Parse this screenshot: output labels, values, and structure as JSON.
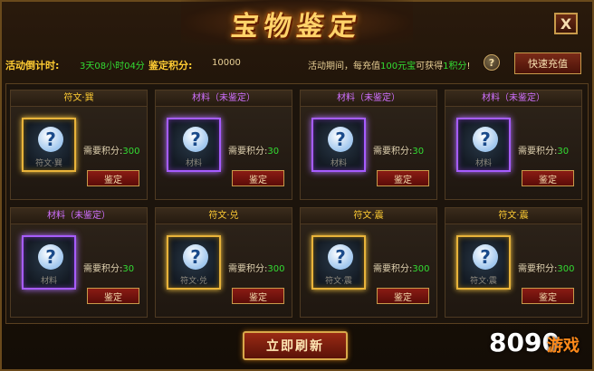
{
  "header": {
    "title": "宝物鉴定",
    "close_label": "X"
  },
  "info": {
    "countdown_label": "活动倒计时:",
    "countdown_value": "3天08小时04分",
    "points_label": "鉴定积分:",
    "points_value": "10000",
    "promo_prefix": "活动期间，每充值",
    "promo_amount": "100元宝",
    "promo_mid": "可获得",
    "promo_points": "1积分",
    "promo_suffix": "!",
    "help_icon": "?",
    "recharge_label": "快速充值"
  },
  "items": [
    {
      "title": "符文·巽",
      "type": "rune",
      "slot_label": "符文·巽",
      "cost_label": "需要积分:",
      "cost": "300",
      "button": "鉴定"
    },
    {
      "title": "材料（未鉴定）",
      "type": "mat",
      "slot_label": "材料",
      "cost_label": "需要积分:",
      "cost": "30",
      "button": "鉴定"
    },
    {
      "title": "材料（未鉴定）",
      "type": "mat",
      "slot_label": "材料",
      "cost_label": "需要积分:",
      "cost": "30",
      "button": "鉴定"
    },
    {
      "title": "材料（未鉴定）",
      "type": "mat",
      "slot_label": "材料",
      "cost_label": "需要积分:",
      "cost": "30",
      "button": "鉴定"
    },
    {
      "title": "材料（未鉴定）",
      "type": "mat",
      "slot_label": "材料",
      "cost_label": "需要积分:",
      "cost": "30",
      "button": "鉴定"
    },
    {
      "title": "符文·兑",
      "type": "rune",
      "slot_label": "符文·兑",
      "cost_label": "需要积分:",
      "cost": "300",
      "button": "鉴定"
    },
    {
      "title": "符文·震",
      "type": "rune",
      "slot_label": "符文·震",
      "cost_label": "需要积分:",
      "cost": "300",
      "button": "鉴定"
    },
    {
      "title": "符文·震",
      "type": "rune",
      "slot_label": "符文·震",
      "cost_label": "需要积分:",
      "cost": "300",
      "button": "鉴定"
    }
  ],
  "footer": {
    "refresh_label": "立即刷新"
  },
  "watermark": {
    "number": "8090",
    "text": "游戏"
  },
  "colors": {
    "gold": "#ffcc33",
    "purple": "#d070ff",
    "green": "#33dd33"
  }
}
